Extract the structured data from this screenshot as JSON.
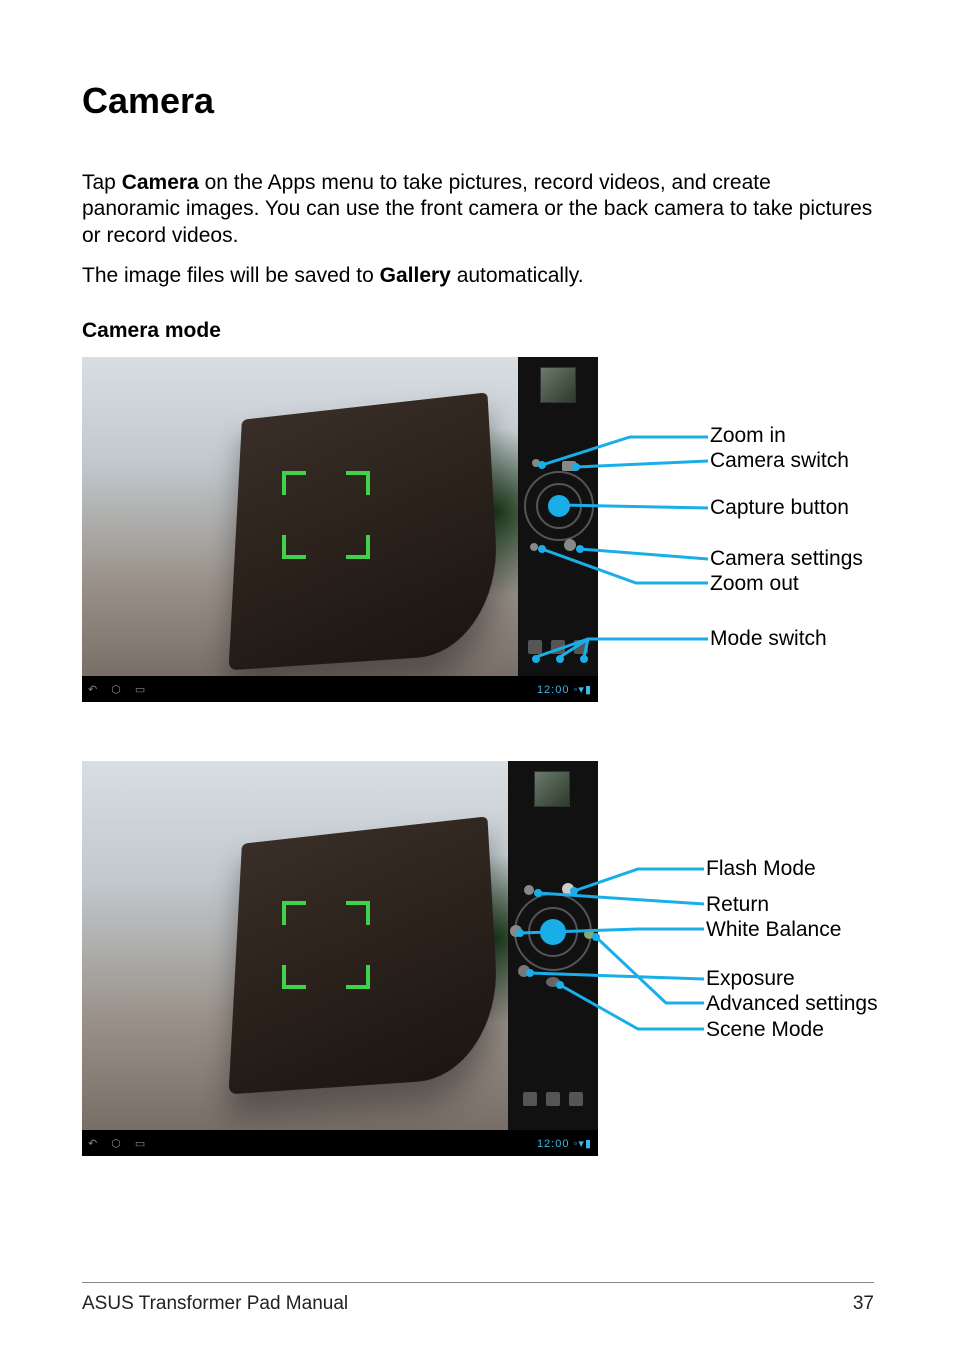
{
  "title": "Camera",
  "intro_prefix": "Tap ",
  "intro_bold1": "Camera",
  "intro_suffix1": " on the Apps menu to take pictures, record videos, and create panoramic images. You can use the front camera or the back camera to take pictures or record videos.",
  "intro2_prefix": "The image files will be saved to ",
  "intro2_bold": "Gallery",
  "intro2_suffix": " automatically.",
  "section": "Camera mode",
  "screenshot_time": "12:00",
  "callouts1": {
    "zoom_in": "Zoom in",
    "camera_switch": "Camera switch",
    "capture_button": "Capture button",
    "camera_settings": "Camera settings",
    "zoom_out": "Zoom out",
    "mode_switch": "Mode switch"
  },
  "callouts2": {
    "flash_mode": "Flash Mode",
    "return": "Return",
    "white_balance": "White Balance",
    "exposure": "Exposure",
    "advanced_settings": "Advanced settings",
    "scene_mode": "Scene Mode"
  },
  "footer_text": "ASUS Transformer Pad Manual",
  "page_number": "37"
}
